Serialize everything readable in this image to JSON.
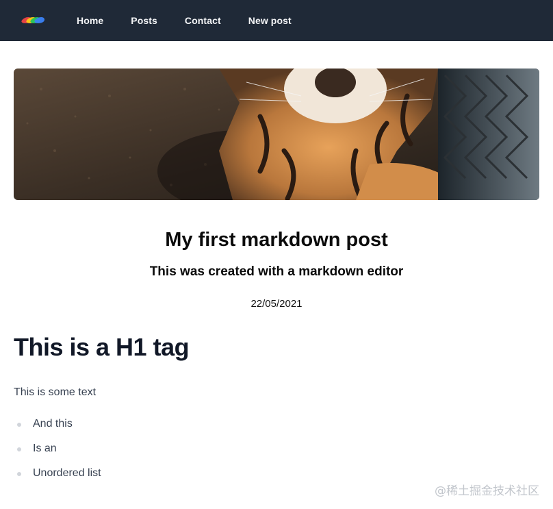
{
  "nav": {
    "logo": "colorful-logo",
    "links": [
      {
        "label": "Home"
      },
      {
        "label": "Posts"
      },
      {
        "label": "Contact"
      },
      {
        "label": "New post"
      }
    ]
  },
  "hero": {
    "image": "tiger-photo"
  },
  "post": {
    "title": "My first markdown post",
    "subtitle": "This was created with a markdown editor",
    "date": "22/05/2021"
  },
  "content": {
    "h1": "This is a H1 tag",
    "paragraph": "This is some text",
    "list": [
      "And this",
      "Is an",
      "Unordered list"
    ]
  },
  "watermark": "@稀土掘金技术社区",
  "colors": {
    "nav_bg": "#1f2937",
    "nav_text": "#f3f4f6",
    "heading": "#111827",
    "body_text": "#374151",
    "bullet": "#d1d5db"
  }
}
